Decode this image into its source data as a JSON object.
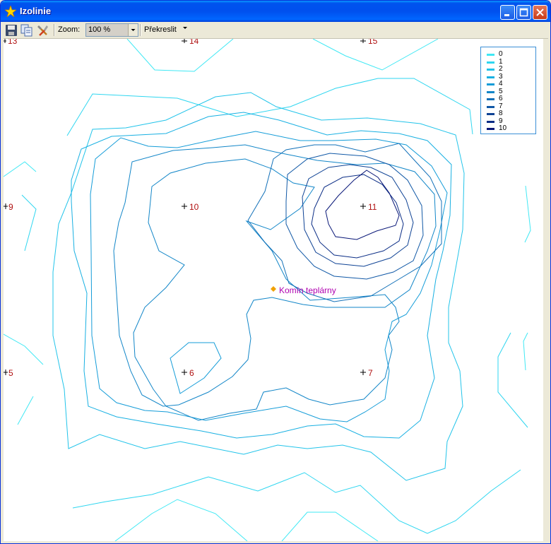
{
  "window": {
    "title": "Izolinie"
  },
  "toolbar": {
    "icons": [
      "save-icon",
      "copy-icon",
      "tools-icon"
    ],
    "zoom_label": "Zoom:",
    "zoom_value": "100 %",
    "redraw_label": "Překreslit"
  },
  "legend": {
    "items": [
      {
        "label": "0",
        "color": "#40e8f4"
      },
      {
        "label": "1",
        "color": "#2ed6f0"
      },
      {
        "label": "2",
        "color": "#22c4ea"
      },
      {
        "label": "3",
        "color": "#18b0e2"
      },
      {
        "label": "4",
        "color": "#149cd8"
      },
      {
        "label": "5",
        "color": "#1286c8"
      },
      {
        "label": "6",
        "color": "#1270b8"
      },
      {
        "label": "7",
        "color": "#1058a6"
      },
      {
        "label": "8",
        "color": "#0e4294"
      },
      {
        "label": "9",
        "color": "#0c2e86"
      },
      {
        "label": "10",
        "color": "#0a1878"
      }
    ]
  },
  "points": [
    {
      "label": "13"
    },
    {
      "label": "14"
    },
    {
      "label": "15"
    },
    {
      "label": "9"
    },
    {
      "label": "10"
    },
    {
      "label": "11"
    },
    {
      "label": "5"
    },
    {
      "label": "6"
    },
    {
      "label": "7"
    }
  ],
  "marker": {
    "label": "Komín teplárny",
    "color": "#f0a000"
  }
}
